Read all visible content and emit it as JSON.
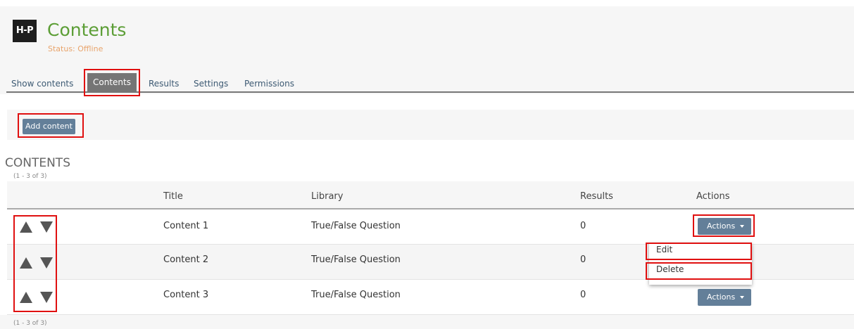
{
  "header": {
    "logo_text": "H-P",
    "title": "Contents",
    "status": "Status: Offline"
  },
  "tabs": [
    {
      "label": "Show contents",
      "active": false
    },
    {
      "label": "Contents",
      "active": true
    },
    {
      "label": "Results",
      "active": false
    },
    {
      "label": "Settings",
      "active": false
    },
    {
      "label": "Permissions",
      "active": false
    }
  ],
  "toolbar": {
    "add_label": "Add content"
  },
  "section": {
    "title": "CONTENTS",
    "count_top": "(1 - 3 of 3)",
    "count_bottom": "(1 - 3 of 3)"
  },
  "table": {
    "columns": [
      "Title",
      "Library",
      "Results",
      "Actions"
    ],
    "rows": [
      {
        "title": "Content 1",
        "library": "True/False Question",
        "results": "0",
        "action": "Actions"
      },
      {
        "title": "Content 2",
        "library": "True/False Question",
        "results": "0",
        "action": ""
      },
      {
        "title": "Content 3",
        "library": "True/False Question",
        "results": "0",
        "action": "Actions"
      }
    ]
  },
  "dropdown": {
    "items": [
      "Edit",
      "Delete"
    ]
  },
  "colors": {
    "accent": "#637f99",
    "title_green": "#5c9e36",
    "status_orange": "#e8a46c",
    "highlight_red": "#e01010"
  },
  "icons": [
    "logo",
    "arrow-up-icon",
    "arrow-down-icon",
    "chevron-down-icon"
  ]
}
